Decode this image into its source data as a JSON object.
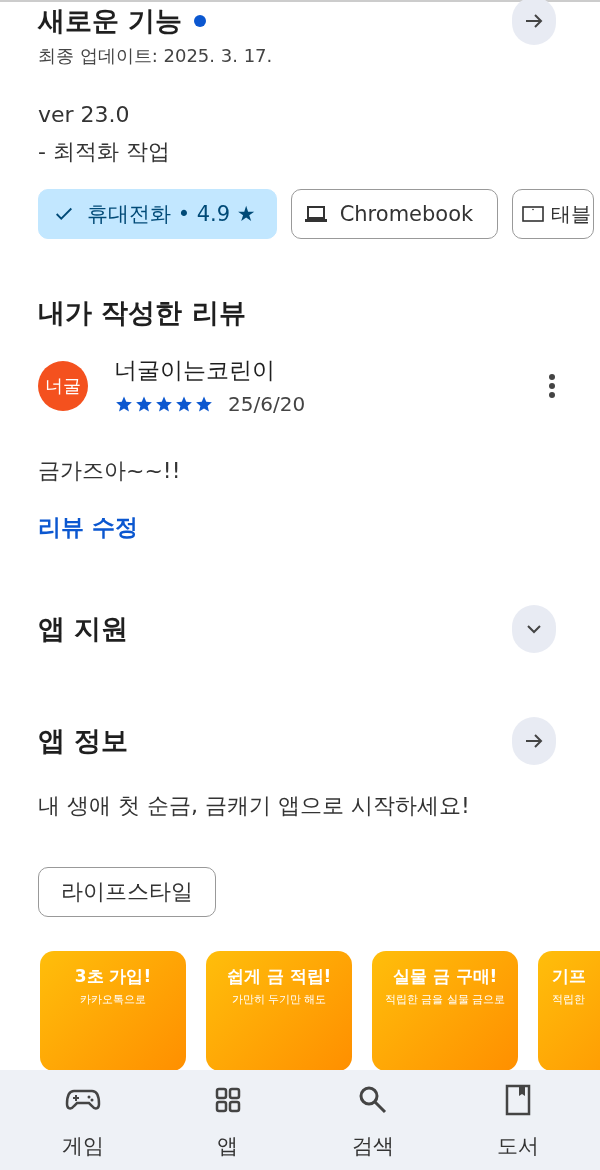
{
  "whats_new": {
    "title": "새로운 기능",
    "unread": true,
    "updated": "최종 업데이트: 2025. 3. 17.",
    "notes": [
      "ver 23.0",
      "- 최적화 작업"
    ]
  },
  "device_chips": [
    {
      "kind": "phone",
      "label": "휴대전화 • 4.9 ★",
      "selected": true
    },
    {
      "kind": "laptop",
      "label": "Chromebook",
      "selected": false
    },
    {
      "kind": "tablet",
      "label": "태블",
      "selected": false
    }
  ],
  "my_review": {
    "heading": "내가 작성한 리뷰",
    "avatar": "너굴",
    "author": "너굴이는코린이",
    "stars": 5,
    "date": "25/6/20",
    "text": "금가즈아~~!!",
    "edit_link": "리뷰 수정"
  },
  "app_support": {
    "title": "앱 지원",
    "expanded": false
  },
  "app_info": {
    "title": "앱 정보",
    "description": "내 생애 첫 순금, 금캐기 앱으로 시작하세요!",
    "category": "라이프스타일"
  },
  "screenshots": [
    {
      "title": "3초 가입!",
      "subtitle": "카카오톡으로"
    },
    {
      "title": "쉽게 금 적립!",
      "subtitle": "가만히 두기만 해도"
    },
    {
      "title": "실물 금 구매!",
      "subtitle": "적립한 금을 실물 금으로"
    },
    {
      "title": "기프",
      "subtitle": "적립한"
    }
  ],
  "bottom_nav": [
    {
      "kind": "games",
      "label": "게임",
      "selected": false
    },
    {
      "kind": "apps",
      "label": "앱",
      "selected": false
    },
    {
      "kind": "search",
      "label": "검색",
      "selected": false
    },
    {
      "kind": "books",
      "label": "도서",
      "selected": false
    }
  ]
}
